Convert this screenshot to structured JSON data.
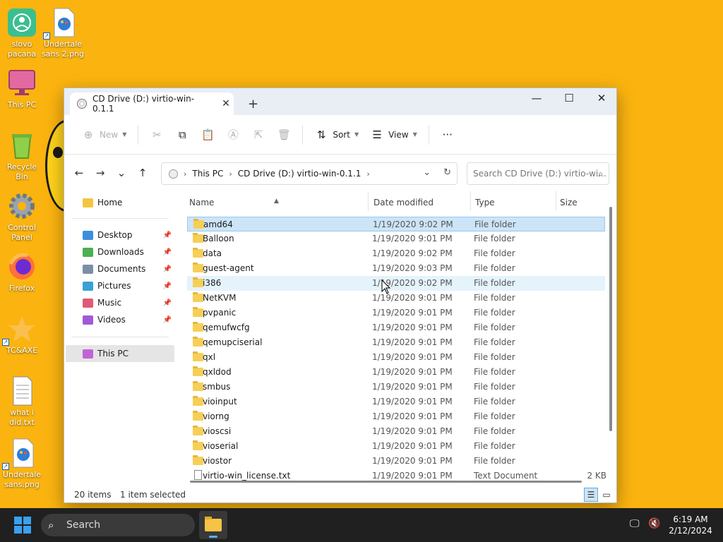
{
  "desktop": {
    "icons": [
      {
        "label": "slovo pacana",
        "icon": "user-app-icon"
      },
      {
        "label": "Undertale sans 2.png",
        "icon": "image-file-icon"
      },
      {
        "label": "This PC",
        "icon": "computer-icon"
      },
      {
        "label": "Recycle Bin",
        "icon": "recycle-bin-icon"
      },
      {
        "label": "Control Panel",
        "icon": "gear-icon"
      },
      {
        "label": "Firefox",
        "icon": "firefox-icon"
      },
      {
        "label": "TC&AXE",
        "icon": "star-icon"
      },
      {
        "label": "what i did.txt",
        "icon": "text-file-icon"
      },
      {
        "label": "Undertale sans.png",
        "icon": "image-file-icon"
      }
    ]
  },
  "window": {
    "tab_title": "CD Drive (D:) virtio-win-0.1.1",
    "toolbar": {
      "new_label": "New",
      "sort_label": "Sort",
      "view_label": "View",
      "more_label": "···"
    },
    "address": {
      "crumbs": [
        "This PC",
        "CD Drive (D:) virtio-win-0.1.1"
      ]
    },
    "search": {
      "placeholder": "Search CD Drive (D:) virtio-wi..."
    },
    "sidebar": {
      "home": "Home",
      "quick": [
        {
          "label": "Desktop",
          "color": "#3c8fde"
        },
        {
          "label": "Downloads",
          "color": "#4caf50"
        },
        {
          "label": "Documents",
          "color": "#7a8fa6"
        },
        {
          "label": "Pictures",
          "color": "#3aa0d8"
        },
        {
          "label": "Music",
          "color": "#e05a77"
        },
        {
          "label": "Videos",
          "color": "#a05ad8"
        }
      ],
      "this_pc": "This PC"
    },
    "columns": {
      "name": "Name",
      "date": "Date modified",
      "type": "Type",
      "size": "Size"
    },
    "files": [
      {
        "name": "amd64",
        "date": "1/19/2020 9:02 PM",
        "type": "File folder",
        "size": ""
      },
      {
        "name": "Balloon",
        "date": "1/19/2020 9:01 PM",
        "type": "File folder",
        "size": ""
      },
      {
        "name": "data",
        "date": "1/19/2020 9:02 PM",
        "type": "File folder",
        "size": ""
      },
      {
        "name": "guest-agent",
        "date": "1/19/2020 9:03 PM",
        "type": "File folder",
        "size": ""
      },
      {
        "name": "i386",
        "date": "1/19/2020 9:02 PM",
        "type": "File folder",
        "size": ""
      },
      {
        "name": "NetKVM",
        "date": "1/19/2020 9:01 PM",
        "type": "File folder",
        "size": ""
      },
      {
        "name": "pvpanic",
        "date": "1/19/2020 9:01 PM",
        "type": "File folder",
        "size": ""
      },
      {
        "name": "qemufwcfg",
        "date": "1/19/2020 9:01 PM",
        "type": "File folder",
        "size": ""
      },
      {
        "name": "qemupciserial",
        "date": "1/19/2020 9:01 PM",
        "type": "File folder",
        "size": ""
      },
      {
        "name": "qxl",
        "date": "1/19/2020 9:01 PM",
        "type": "File folder",
        "size": ""
      },
      {
        "name": "qxldod",
        "date": "1/19/2020 9:01 PM",
        "type": "File folder",
        "size": ""
      },
      {
        "name": "smbus",
        "date": "1/19/2020 9:01 PM",
        "type": "File folder",
        "size": ""
      },
      {
        "name": "vioinput",
        "date": "1/19/2020 9:01 PM",
        "type": "File folder",
        "size": ""
      },
      {
        "name": "viorng",
        "date": "1/19/2020 9:01 PM",
        "type": "File folder",
        "size": ""
      },
      {
        "name": "vioscsi",
        "date": "1/19/2020 9:01 PM",
        "type": "File folder",
        "size": ""
      },
      {
        "name": "vioserial",
        "date": "1/19/2020 9:01 PM",
        "type": "File folder",
        "size": ""
      },
      {
        "name": "viostor",
        "date": "1/19/2020 9:01 PM",
        "type": "File folder",
        "size": ""
      },
      {
        "name": "virtio-win_license.txt",
        "date": "1/19/2020 9:01 PM",
        "type": "Text Document",
        "size": "2 KB"
      }
    ],
    "selected_index": 0,
    "hover_index": 4,
    "status": {
      "items": "20 items",
      "selection": "1 item selected"
    }
  },
  "taskbar": {
    "search_label": "Search",
    "time": "6:19 AM",
    "date": "2/12/2024"
  },
  "colors": {
    "desktop_bg": "#fbb40f",
    "selection": "#cce4f7",
    "accent": "#3aa0f0"
  }
}
